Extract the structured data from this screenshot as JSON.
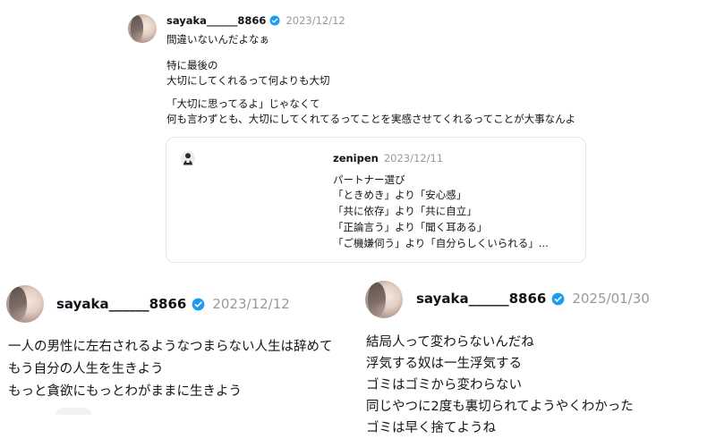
{
  "colors": {
    "verified_badge": "#1d9bf0",
    "date_text": "#999999",
    "quote_border": "#e6e6e6"
  },
  "post1": {
    "username": "sayaka______8866",
    "date": "2023/12/12",
    "lines": [
      "間違いないんだよなぁ",
      "特に最後の",
      "大切にしてくれるって何よりも大切",
      "「大切に思ってるよ」じゃなくて",
      "何も言わずとも、大切にしてくれてるってことを実感させてくれるってことが大事なんよ"
    ],
    "quote": {
      "avatar_icon": "zenipen-avatar-icon",
      "username": "zenipen",
      "date": "2023/12/11",
      "lines": [
        "パートナー選び",
        "「ときめき」より「安心感」",
        "「共に依存」より「共に自立」",
        "「正論言う」より「聞く耳ある」",
        "「ご機嫌伺う」より「自分らしくいられる」..."
      ]
    }
  },
  "post2": {
    "username": "sayaka______8866",
    "date": "2023/12/12",
    "lines": [
      "一人の男性に左右されるようなつまらない人生は辞めて",
      "もう自分の人生を生きよう",
      "もっと貪欲にもっとわがままに生きよう"
    ]
  },
  "post3": {
    "username": "sayaka______8866",
    "date": "2025/01/30",
    "lines": [
      "結局人って変わらないんだね",
      "浮気する奴は一生浮気する",
      "ゴミはゴミから変わらない",
      "同じやつに2度も裏切られてようやくわかった",
      "ゴミは早く捨てようね"
    ]
  }
}
